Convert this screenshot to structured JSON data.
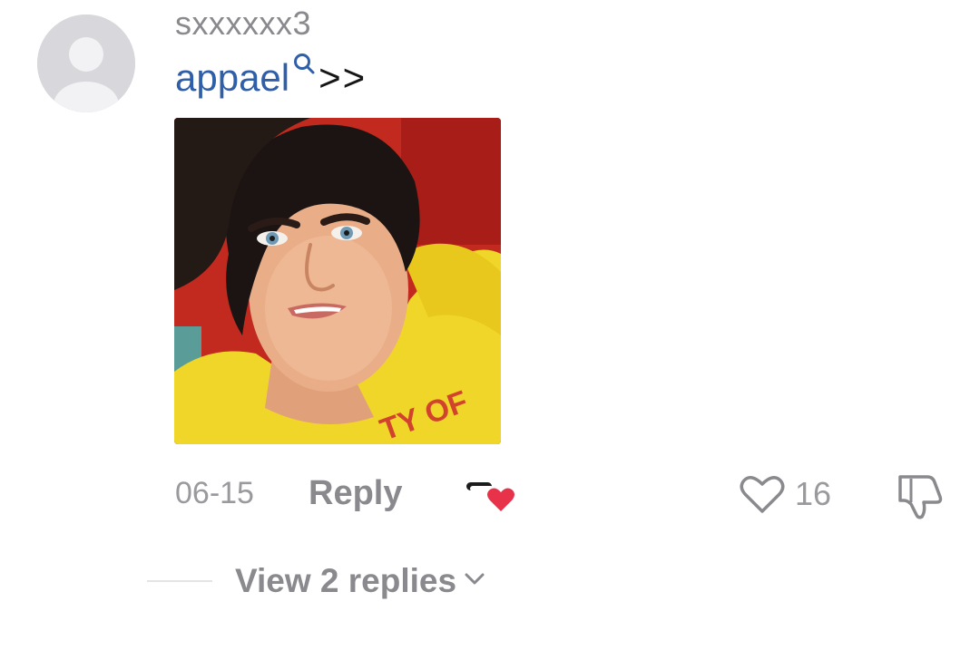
{
  "comment": {
    "username": "sxxxxxx3",
    "text_link": "appael",
    "text_suffix": ">>",
    "date": "06-15",
    "reply_label": "Reply",
    "like_count": "16",
    "view_replies_label": "View 2 replies"
  },
  "icons": {
    "avatar": "default-avatar-icon",
    "search": "search-icon",
    "creator_liked": "creator-liked-heart-icon",
    "like": "heart-outline-icon",
    "dislike": "thumbs-down-icon",
    "expand": "chevron-down-icon"
  },
  "colors": {
    "link": "#2f5fa8",
    "secondary_text": "#8a8a8e",
    "heart_red": "#e8324a",
    "avatar_bg": "#d8d8dc"
  }
}
